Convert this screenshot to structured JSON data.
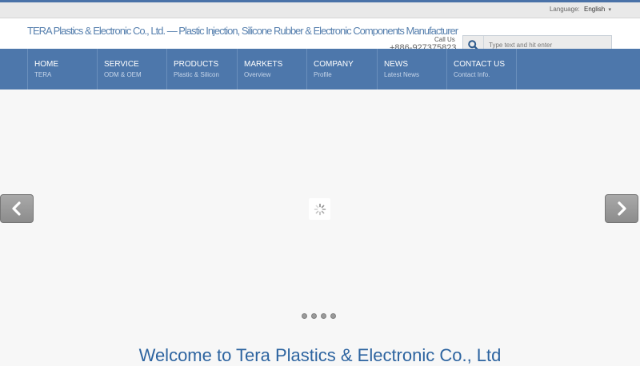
{
  "topbar": {
    "language_label": "Language:",
    "language_value": "English"
  },
  "header": {
    "logo_text": "TERA Plastics & Electronic Co., Ltd. — Plastic Injection, Silicone Rubber & Electronic Components Manufacturer",
    "call_us_label": "Call Us",
    "phone": "+886-927375823"
  },
  "search": {
    "placeholder": "Type text and hit enter"
  },
  "nav": {
    "items": [
      {
        "title": "HOME",
        "subtitle": "TERA"
      },
      {
        "title": "SERVICE",
        "subtitle": "ODM & OEM"
      },
      {
        "title": "PRODUCTS",
        "subtitle": "Plastic & Silicon"
      },
      {
        "title": "MARKETS",
        "subtitle": "Overview"
      },
      {
        "title": "COMPANY",
        "subtitle": "Profile"
      },
      {
        "title": "NEWS",
        "subtitle": "Latest News"
      },
      {
        "title": "CONTACT US",
        "subtitle": "Contact Info."
      }
    ]
  },
  "slider": {
    "prev_icon": "chevron-left-icon",
    "next_icon": "chevron-right-icon",
    "loading_icon": "spinner-icon",
    "dot_count": 4
  },
  "welcome": {
    "heading": "Welcome to Tera Plastics & Electronic Co., Ltd"
  },
  "colors": {
    "nav_bg": "#4d77ab",
    "accent": "#2d64a0",
    "top_line": "#4a72a8"
  }
}
